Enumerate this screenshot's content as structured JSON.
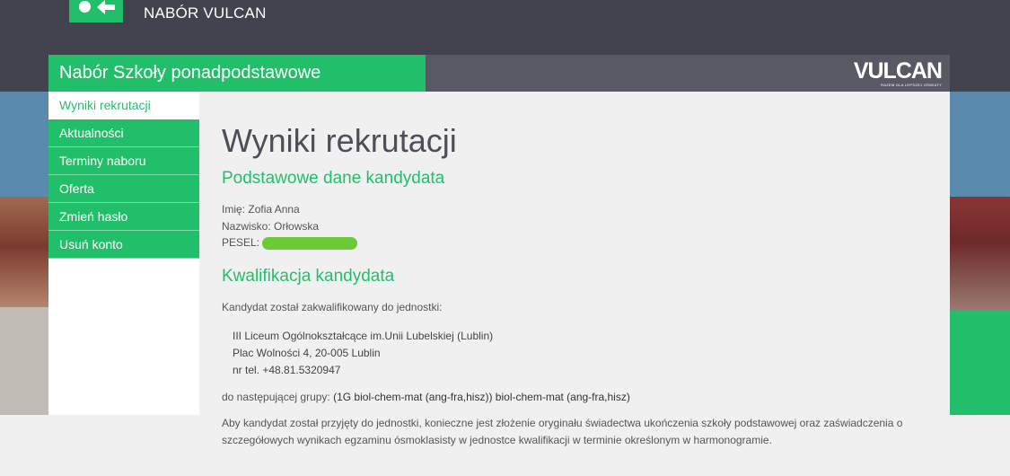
{
  "header": {
    "app_title": "NABÓR VULCAN"
  },
  "panel": {
    "module_title": "Nabór Szkoły ponadpodstawowe",
    "brand_name": "VULCAN",
    "brand_tagline": "RAZEM DLA LEPSZEJ OŚWIATY"
  },
  "sidebar": {
    "items": [
      {
        "label": "Wyniki rekrutacji",
        "active": true
      },
      {
        "label": "Aktualności",
        "active": false
      },
      {
        "label": "Terminy naboru",
        "active": false
      },
      {
        "label": "Oferta",
        "active": false
      },
      {
        "label": "Zmień hasło",
        "active": false
      },
      {
        "label": "Usuń konto",
        "active": false
      }
    ]
  },
  "main": {
    "page_title": "Wyniki rekrutacji",
    "basic_data": {
      "heading": "Podstawowe dane kandydata",
      "first_name_label": "Imię:",
      "first_name": "Zofia Anna",
      "last_name_label": "Nazwisko:",
      "last_name": "Orłowska",
      "pesel_label": "PESEL:"
    },
    "qualification": {
      "heading": "Kwalifikacja kandydata",
      "intro": "Kandydat został zakwalifikowany do jednostki:",
      "unit_name": "III Liceum Ogólnokształcące im.Unii Lubelskiej (Lublin)",
      "unit_address": "Plac Wolności 4, 20-005 Lublin",
      "unit_phone": "nr tel. +48.81.5320947",
      "group_label": "do następującej grupy:",
      "group_value": "(1G biol-chem-mat (ang-fra,hisz)) biol-chem-mat (ang-fra,hisz)",
      "note": "Aby kandydat został przyjęty do jednostki, konieczne jest złożenie oryginału świadectwa ukończenia szkoły podstawowej oraz zaświadczenia o szczegółowych wynikach egzaminu ósmoklasisty w jednostce kwalifikacji w terminie określonym w harmonogramie."
    }
  },
  "colors": {
    "accent_green": "#22bf6a",
    "header_dark": "#43434f",
    "panel_grey": "#595965",
    "pesel_mask": "#6acb37"
  }
}
